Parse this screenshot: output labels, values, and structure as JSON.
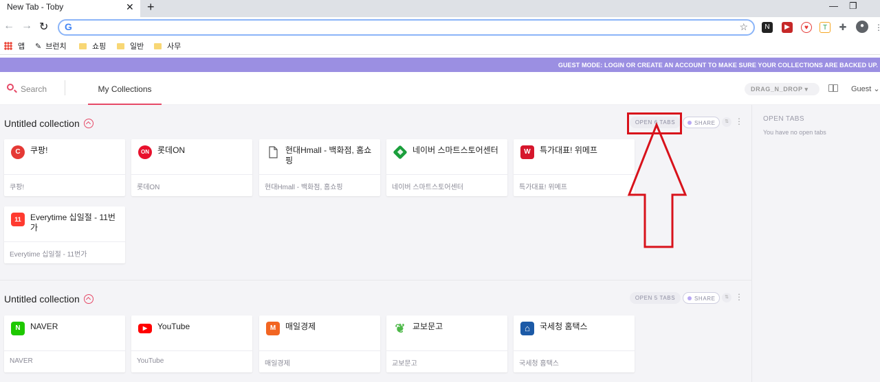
{
  "browser": {
    "tab_title": "New Tab - Toby",
    "tab_close": "✕",
    "new_tab": "+",
    "window_controls": [
      "—",
      "❐"
    ],
    "back": "←",
    "forward": "→",
    "reload": "↻",
    "omnibox_logo": "G",
    "omnibox_placeholder": "",
    "star": "☆",
    "bookmarks": [
      {
        "label": "앱"
      },
      {
        "label": "브런치"
      },
      {
        "label": "쇼핑"
      },
      {
        "label": "일반"
      },
      {
        "label": "사무"
      }
    ]
  },
  "banner": {
    "text": "GUEST MODE: LOGIN OR CREATE AN ACCOUNT TO MAKE SURE YOUR COLLECTIONS ARE BACKED UP."
  },
  "header": {
    "search_label": "Search",
    "my_collections": "My Collections",
    "drag_mode": "DRAG_N_DROP ▾",
    "guest": "Guest ⌄"
  },
  "sidebar": {
    "title": "OPEN TABS",
    "empty": "You have no open tabs"
  },
  "collections": [
    {
      "title": "Untitled collection",
      "open_label": "OPEN 6 TABS",
      "share_label": "SHARE",
      "cards": [
        {
          "title": "쿠팡!",
          "url": "쿠팡!",
          "icon": "C",
          "color": "#e53935"
        },
        {
          "title": "롯데ON",
          "url": "롯데ON",
          "icon": "ON",
          "color": "#e8112d"
        },
        {
          "title": "현대Hmall - 백화점, 홈쇼핑",
          "url": "현대Hmall - 백화점, 홈쇼핑",
          "icon": "doc-icon",
          "color": "#ffffff"
        },
        {
          "title": "네이버 스마트스토어센터",
          "url": "네이버 스마트스토어센터",
          "icon": "▦",
          "color": "#1b9f3c"
        },
        {
          "title": "특가대표! 위메프",
          "url": "특가대표! 위메프",
          "icon": "W",
          "color": "#d6162c"
        },
        {
          "title": "Everytime 십일절 - 11번가",
          "url": "Everytime 십일절 - 11번가",
          "icon": "11",
          "color": "#ff3b30"
        }
      ]
    },
    {
      "title": "Untitled collection",
      "open_label": "OPEN 5 TABS",
      "share_label": "SHARE",
      "cards": [
        {
          "title": "NAVER",
          "url": "NAVER",
          "icon": "N",
          "color": "#1ec800"
        },
        {
          "title": "YouTube",
          "url": "YouTube",
          "icon": "▶",
          "color": "#ff0000"
        },
        {
          "title": "매일경제",
          "url": "매일경제",
          "icon": "M",
          "color": "#f26522"
        },
        {
          "title": "교보문고",
          "url": "교보문고",
          "icon": "❦",
          "color": "#4db848"
        },
        {
          "title": "국세청 홈택스",
          "url": "국세청 홈택스",
          "icon": "⌂",
          "color": "#1c5aa7"
        }
      ]
    }
  ],
  "colors": {
    "accent": "#e64866",
    "banner": "#9b8fe2",
    "annotation_red": "#d8121b"
  }
}
